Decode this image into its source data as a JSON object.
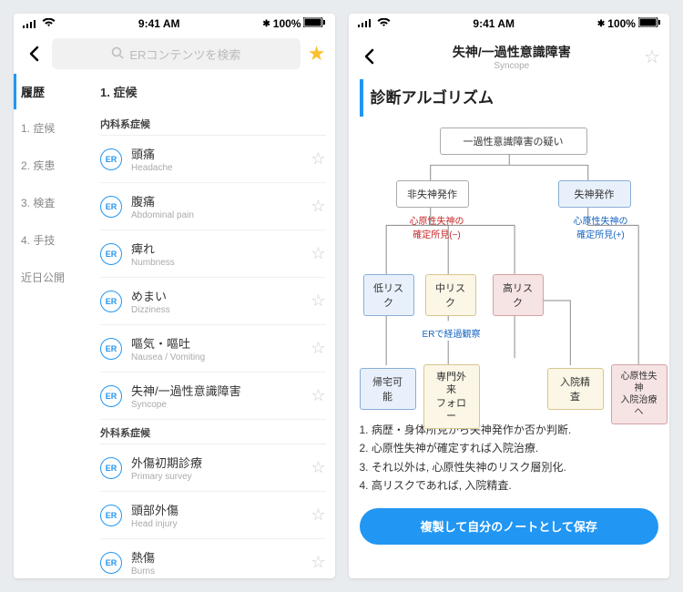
{
  "status": {
    "time": "9:41 AM",
    "battery": "100%"
  },
  "left": {
    "search_placeholder": "ERコンテンツを検索",
    "sidebar": {
      "active": "履歴",
      "items": [
        "1. 症候",
        "2. 疾患",
        "3. 検査",
        "4. 手技",
        "近日公開"
      ]
    },
    "section_title": "1. 症候",
    "sub1": "内科系症候",
    "sub2": "外科系症候",
    "internal": [
      {
        "jp": "頭痛",
        "en": "Headache"
      },
      {
        "jp": "腹痛",
        "en": "Abdominal pain"
      },
      {
        "jp": "痺れ",
        "en": "Numbness"
      },
      {
        "jp": "めまい",
        "en": "Dizziness"
      },
      {
        "jp": "嘔気・嘔吐",
        "en": "Nausea / Vomiting"
      },
      {
        "jp": "失神/一過性意識障害",
        "en": "Syncope"
      }
    ],
    "external": [
      {
        "jp": "外傷初期診療",
        "en": "Primary survey"
      },
      {
        "jp": "頭部外傷",
        "en": "Head injury"
      },
      {
        "jp": "熱傷",
        "en": "Burns"
      }
    ],
    "badge_text": "ER"
  },
  "right": {
    "title_jp": "失神/一過性意識障害",
    "title_en": "Syncope",
    "algo_title": "診断アルゴリズム",
    "boxes": {
      "suspect": "一過性意識障害の疑い",
      "non_syncope": "非失神発作",
      "syncope": "失神発作",
      "label_neg": "心原性失神の\n確定所見(−)",
      "label_pos": "心原性失神の\n確定所見(+)",
      "low": "低リスク",
      "mid": "中リスク",
      "high": "高リスク",
      "er_follow": "ERで経過観察",
      "go_home": "帰宅可能",
      "outpatient": "専門外来\nフォロー",
      "admit_eval": "入院精査",
      "cardiac_admit": "心原性失神\n入院治療へ"
    },
    "notes": [
      "1. 病歴・身体所見から失神発作か否か判断.",
      "2. 心原性失神が確定すれば入院治療.",
      "3. それ以外は, 心原性失神のリスク層別化.",
      "4. 高リスクであれば, 入院精査."
    ],
    "copy_btn": "複製して自分のノートとして保存"
  }
}
